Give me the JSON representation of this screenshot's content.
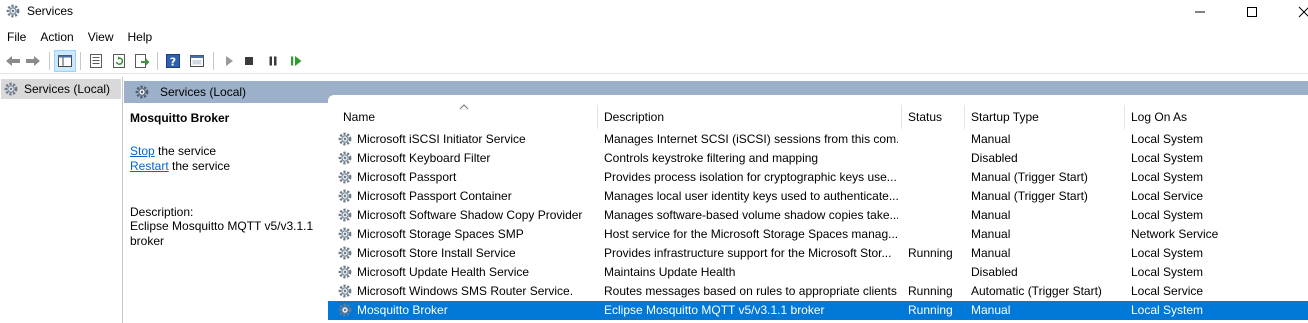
{
  "window": {
    "title": "Services"
  },
  "menu": [
    "File",
    "Action",
    "View",
    "Help"
  ],
  "tree": {
    "root_label": "Services (Local)"
  },
  "content": {
    "header_label": "Services (Local)",
    "selected_service": {
      "name": "Mosquitto Broker",
      "stop_link": "Stop",
      "stop_suffix": " the service",
      "restart_link": "Restart",
      "restart_suffix": " the service",
      "description_label": "Description:",
      "description": "Eclipse Mosquitto MQTT v5/v3.1.1 broker"
    }
  },
  "list": {
    "columns": [
      "Name",
      "Description",
      "Status",
      "Startup Type",
      "Log On As"
    ],
    "rows": [
      {
        "name": "Microsoft iSCSI Initiator Service",
        "description": "Manages Internet SCSI (iSCSI) sessions from this com...",
        "status": "",
        "startup": "Manual",
        "logon": "Local System"
      },
      {
        "name": "Microsoft Keyboard Filter",
        "description": "Controls keystroke filtering and mapping",
        "status": "",
        "startup": "Disabled",
        "logon": "Local System"
      },
      {
        "name": "Microsoft Passport",
        "description": "Provides process isolation for cryptographic keys use...",
        "status": "",
        "startup": "Manual (Trigger Start)",
        "logon": "Local System"
      },
      {
        "name": "Microsoft Passport Container",
        "description": "Manages local user identity keys used to authenticate...",
        "status": "",
        "startup": "Manual (Trigger Start)",
        "logon": "Local Service"
      },
      {
        "name": "Microsoft Software Shadow Copy Provider",
        "description": "Manages software-based volume shadow copies take...",
        "status": "",
        "startup": "Manual",
        "logon": "Local System"
      },
      {
        "name": "Microsoft Storage Spaces SMP",
        "description": "Host service for the Microsoft Storage Spaces manag...",
        "status": "",
        "startup": "Manual",
        "logon": "Network Service"
      },
      {
        "name": "Microsoft Store Install Service",
        "description": "Provides infrastructure support for the Microsoft Stor...",
        "status": "Running",
        "startup": "Manual",
        "logon": "Local System"
      },
      {
        "name": "Microsoft Update Health Service",
        "description": "Maintains Update Health",
        "status": "",
        "startup": "Disabled",
        "logon": "Local System"
      },
      {
        "name": "Microsoft Windows SMS Router Service.",
        "description": "Routes messages based on rules to appropriate clients.",
        "status": "Running",
        "startup": "Automatic (Trigger Start)",
        "logon": "Local Service"
      },
      {
        "name": "Mosquitto Broker",
        "description": "Eclipse Mosquitto MQTT v5/v3.1.1 broker",
        "status": "Running",
        "startup": "Manual",
        "logon": "Local System",
        "selected": true
      }
    ]
  },
  "icons": {
    "app": "services-gear-icon",
    "toolbar": [
      "back-arrow-icon",
      "forward-arrow-icon",
      "show-hide-tree-icon",
      "properties-icon",
      "refresh-icon",
      "export-list-icon",
      "help-icon",
      "console-tree-icon",
      "start-service-icon",
      "stop-service-icon",
      "pause-service-icon",
      "resume-service-icon"
    ]
  },
  "colors": {
    "selection": "#0078d7",
    "header_band": "#9cb1c9",
    "link": "#0066cc",
    "resume_green": "#2aa02a"
  }
}
